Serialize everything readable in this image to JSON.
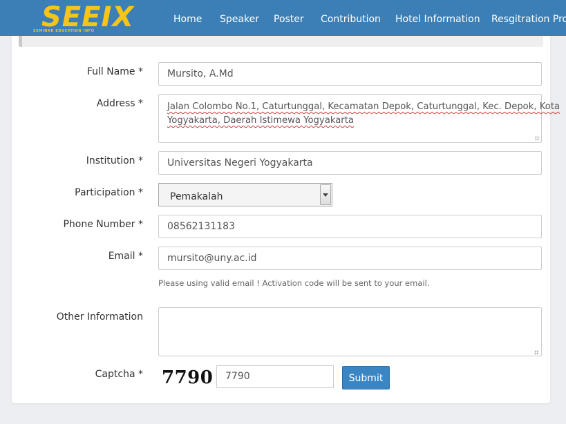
{
  "brand": {
    "logo_text": "SEEIX",
    "logo_tagline": "SEMINAR EDUCATION INFO"
  },
  "nav": {
    "items": [
      {
        "label": "Home"
      },
      {
        "label": "Speaker"
      },
      {
        "label": "Poster"
      },
      {
        "label": "Contribution"
      },
      {
        "label": "Hotel Information"
      },
      {
        "label": "Resgitration Proce"
      }
    ]
  },
  "form": {
    "full_name": {
      "label": "Full Name *",
      "value": "Mursito, A.Md"
    },
    "address": {
      "label": "Address *",
      "value_line1": "Jalan Colombo No.1, Caturtunggal, Kecamatan Depok, Caturtunggal, Kec. Depok, Kota",
      "value_line2": "Yogyakarta, Daerah Istimewa Yogyakarta"
    },
    "institution": {
      "label": "Institution *",
      "value": "Universitas Negeri Yogyakarta"
    },
    "participation": {
      "label": "Participation *",
      "selected": "Pemakalah"
    },
    "phone": {
      "label": "Phone Number *",
      "value": "08562131183"
    },
    "email": {
      "label": "Email *",
      "value": "mursito@uny.ac.id",
      "help": "Please using valid email ! Activation code will be sent to your email."
    },
    "other_info": {
      "label": "Other Information",
      "value": ""
    },
    "captcha": {
      "label": "Captcha *",
      "code": "7790",
      "value": "7790"
    },
    "submit_label": "Submit"
  },
  "colors": {
    "navbar": "#3b7fb6",
    "logo": "#f7c519",
    "submit": "#3b86c2",
    "page_bg": "#eceef1"
  }
}
